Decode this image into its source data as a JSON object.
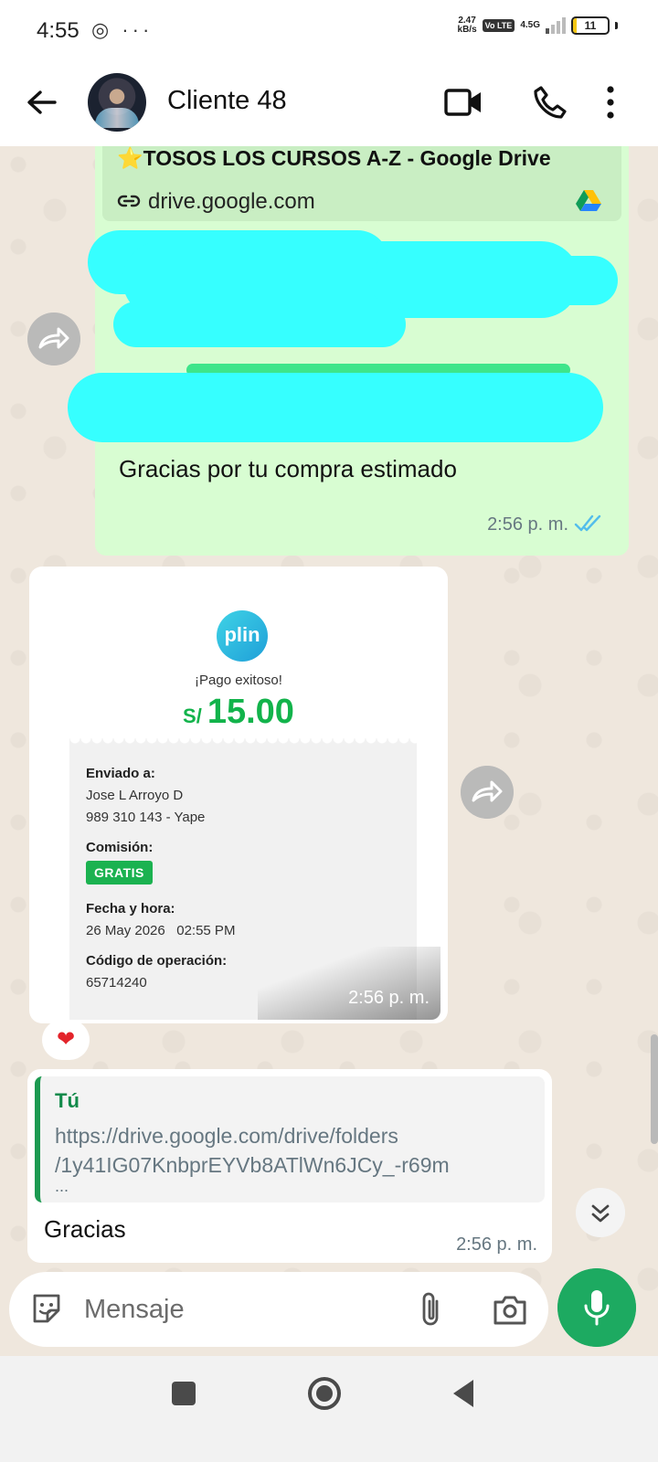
{
  "status_bar": {
    "time": "4:55",
    "left_icons": "◎ ···",
    "net_speed_top": "2.47",
    "net_speed_unit": "kB/s",
    "volte": "Vo LTE",
    "network": "4.5G",
    "battery": "11",
    "battery_level_percent": 11,
    "battery_color": "#f3c613"
  },
  "header": {
    "contact_name": "Cliente 48",
    "icons": [
      "arrow-back-icon",
      "video-call-icon",
      "phone-icon",
      "more-vert-icon"
    ]
  },
  "outgoing_message": {
    "link_title": "⭐TOSOS LOS CURSOS A-Z - Google Drive",
    "link_domain": "drive.google.com",
    "text": "Gracias por tu compra estimado",
    "time": "2:56 p. m.",
    "status": "read",
    "bubble_color": "#d8fdd2"
  },
  "receipt": {
    "logo_text": "plin",
    "status": "¡Pago exitoso!",
    "currency": "S/",
    "amount": "15.00",
    "sent_to_label": "Enviado a:",
    "recipient_name": "Jose L Arroyo D",
    "recipient_phone": "989 310 143 - Yape",
    "commission_label": "Comisión:",
    "commission_value": "GRATIS",
    "datetime_label": "Fecha y hora:",
    "datetime_value": "26 May 2026   02:55 PM",
    "operation_label": "Código de operación:",
    "operation_value": "65714240",
    "time": "2:56 p. m.",
    "accent_color": "#12b34b"
  },
  "reaction": "❤",
  "reply_message": {
    "quote_author": "Tú",
    "quote_line1": "https://drive.google.com/drive/folders",
    "quote_line2": "/1y41IG07KnbprEYVb8ATlWn6JCy_-r69m",
    "quote_line3": "...",
    "text": "Gracias",
    "time": "2:56 p. m."
  },
  "input": {
    "placeholder": "Mensaje"
  },
  "colors": {
    "brand_green": "#1daa61",
    "chat_bg": "#efe7dd"
  }
}
